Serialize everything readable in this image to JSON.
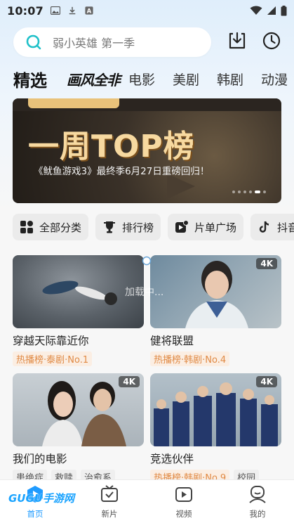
{
  "status_bar": {
    "time": "10:07"
  },
  "search": {
    "placeholder": "弱小英雄 第一季"
  },
  "tabs": [
    {
      "label": "精选",
      "active": true
    },
    {
      "label": "画风全非",
      "logo": true
    },
    {
      "label": "电影"
    },
    {
      "label": "美剧"
    },
    {
      "label": "韩剧"
    },
    {
      "label": "动漫"
    }
  ],
  "banner": {
    "title": "一周TOP榜",
    "subtitle": "《鱿鱼游戏3》最终季6月27日重磅回归！"
  },
  "chips": [
    {
      "label": "全部分类",
      "icon": "category-icon"
    },
    {
      "label": "排行榜",
      "icon": "trophy-icon"
    },
    {
      "label": "片单广场",
      "icon": "playlist-icon"
    },
    {
      "label": "抖音",
      "icon": "tiktok-icon"
    }
  ],
  "cards": [
    {
      "title": "穿越天际靠近你",
      "badge": "",
      "tags": [
        {
          "text": "热播榜·泰剧·No.1",
          "style": "hot"
        }
      ]
    },
    {
      "title": "健将联盟",
      "badge": "4K",
      "tags": [
        {
          "text": "热播榜·韩剧·No.4",
          "style": "hot"
        }
      ]
    },
    {
      "title": "我们的电影",
      "badge": "4K",
      "tags": [
        {
          "text": "患绝症",
          "style": "gray"
        },
        {
          "text": "救赎",
          "style": "gray"
        },
        {
          "text": "治愈系",
          "style": "gray"
        }
      ]
    },
    {
      "title": "竞选伙伴",
      "badge": "4K",
      "tags": [
        {
          "text": "热播榜·韩剧·No.9",
          "style": "hot"
        },
        {
          "text": "校园",
          "style": "gray"
        }
      ]
    }
  ],
  "loading_text": "加载中...",
  "bottom_nav": [
    {
      "label": "首页",
      "active": true
    },
    {
      "label": "新片"
    },
    {
      "label": "视频"
    },
    {
      "label": "我的"
    }
  ],
  "watermark": "GUGU手游网",
  "colors": {
    "accent": "#1f9bff",
    "hot_tag": "#e08a45",
    "banner_gold": "#f7d9a0"
  }
}
